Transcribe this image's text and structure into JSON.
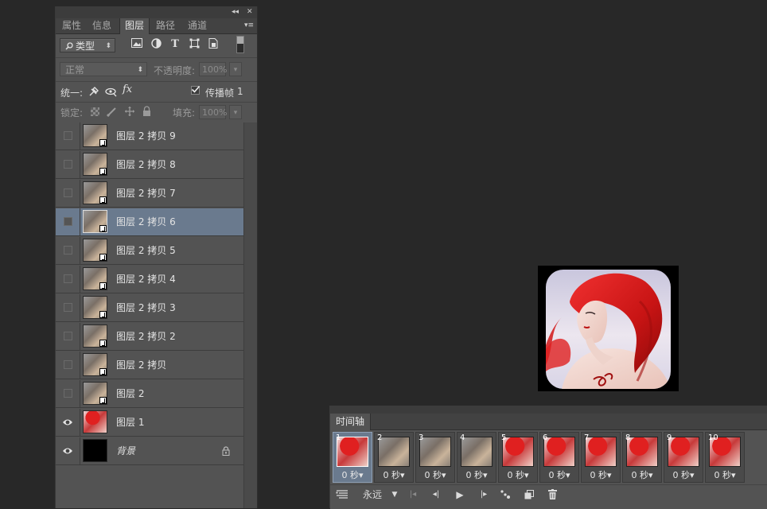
{
  "layers_panel": {
    "tabs": [
      {
        "label": "属性",
        "active": false
      },
      {
        "label": "信息",
        "active": false
      },
      {
        "label": "图层",
        "active": true
      },
      {
        "label": "路径",
        "active": false
      },
      {
        "label": "通道",
        "active": false
      }
    ],
    "topstrip": {
      "collapse": "◂◂",
      "close": "✕"
    },
    "tab_menu": "▾≡",
    "filter": {
      "kind_label": "类型",
      "kind_icon": "search-icon"
    },
    "blend": {
      "mode": "正常",
      "opacity_label": "不透明度:",
      "opacity_value": "100%"
    },
    "unify": {
      "label": "统一:",
      "propagate_label": "传播帧",
      "propagate_value": "1",
      "propagate_checked": true
    },
    "lock": {
      "label": "锁定:",
      "fill_label": "填充:",
      "fill_value": "100%"
    },
    "layers": [
      {
        "name": "图层 2 拷贝 9",
        "visible": false,
        "thumb": "gray",
        "smart": true,
        "selected": false
      },
      {
        "name": "图层 2 拷贝 8",
        "visible": false,
        "thumb": "gray",
        "smart": true,
        "selected": false
      },
      {
        "name": "图层 2 拷贝 7",
        "visible": false,
        "thumb": "gray",
        "smart": true,
        "selected": false
      },
      {
        "name": "图层 2 拷贝 6",
        "visible": false,
        "thumb": "gray",
        "smart": true,
        "selected": true
      },
      {
        "name": "图层 2 拷贝 5",
        "visible": false,
        "thumb": "gray",
        "smart": true,
        "selected": false
      },
      {
        "name": "图层 2 拷贝 4",
        "visible": false,
        "thumb": "gray",
        "smart": true,
        "selected": false
      },
      {
        "name": "图层 2 拷贝 3",
        "visible": false,
        "thumb": "gray",
        "smart": true,
        "selected": false
      },
      {
        "name": "图层 2 拷贝 2",
        "visible": false,
        "thumb": "gray",
        "smart": true,
        "selected": false
      },
      {
        "name": "图层 2 拷贝",
        "visible": false,
        "thumb": "gray",
        "smart": true,
        "selected": false
      },
      {
        "name": "图层 2",
        "visible": false,
        "thumb": "gray",
        "smart": true,
        "selected": false
      },
      {
        "name": "图层 1",
        "visible": true,
        "thumb": "color",
        "smart": false,
        "selected": false
      },
      {
        "name": "背景",
        "visible": true,
        "thumb": "black",
        "smart": false,
        "selected": false,
        "locked": true,
        "italic": true
      }
    ]
  },
  "timeline": {
    "tab_label": "时间轴",
    "frames": [
      {
        "num": "1",
        "delay": "0 秒▾",
        "selected": true,
        "thumb": "color"
      },
      {
        "num": "2",
        "delay": "0 秒▾",
        "selected": false,
        "thumb": "gray"
      },
      {
        "num": "3",
        "delay": "0 秒▾",
        "selected": false,
        "thumb": "gray"
      },
      {
        "num": "4",
        "delay": "0 秒▾",
        "selected": false,
        "thumb": "gray"
      },
      {
        "num": "5",
        "delay": "0 秒▾",
        "selected": false,
        "thumb": "color"
      },
      {
        "num": "6",
        "delay": "0 秒▾",
        "selected": false,
        "thumb": "color"
      },
      {
        "num": "7",
        "delay": "0 秒▾",
        "selected": false,
        "thumb": "color"
      },
      {
        "num": "8",
        "delay": "0 秒▾",
        "selected": false,
        "thumb": "color"
      },
      {
        "num": "9",
        "delay": "0 秒▾",
        "selected": false,
        "thumb": "color"
      },
      {
        "num": "10",
        "delay": "0 秒▾",
        "selected": false,
        "thumb": "color"
      }
    ],
    "loop_label": "永远"
  },
  "colors": {
    "panel_bg": "#535353",
    "app_bg": "#282828",
    "selected_row": "#6a7a8e",
    "hair_red": "#d81e1e"
  }
}
